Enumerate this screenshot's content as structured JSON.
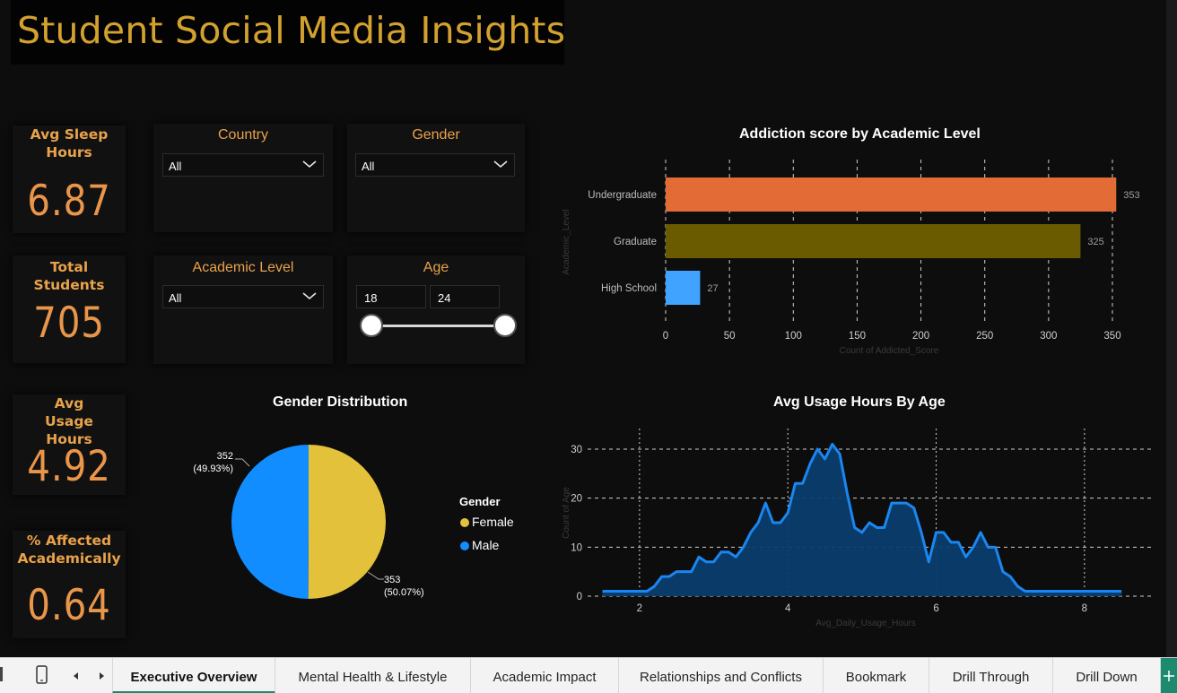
{
  "title": "Student Social Media Insights",
  "kpis": [
    {
      "label": "Avg Sleep Hours",
      "value": "6.87"
    },
    {
      "label": "Total Students",
      "value": "705"
    },
    {
      "label": "Avg Usage Hours",
      "value": "4.92"
    },
    {
      "label": "% Affected Academically",
      "value": "0.64"
    }
  ],
  "slicers": {
    "country": {
      "title": "Country",
      "value": "All"
    },
    "gender": {
      "title": "Gender",
      "value": "All"
    },
    "academic_level": {
      "title": "Academic Level",
      "value": "All"
    },
    "age": {
      "title": "Age",
      "min": "18",
      "max": "24"
    }
  },
  "charts": {
    "addiction_title": "Addiction score by Academic Level",
    "gender_title": "Gender Distribution",
    "usage_title": "Avg Usage Hours By Age"
  },
  "colors": {
    "title_gold": "#d3a12f",
    "kpi_orange": "#e9954a",
    "undergraduate": "#e36b36",
    "graduate": "#6b5b00",
    "high_school": "#3fa3ff",
    "female": "#e3c13a",
    "male": "#128dff",
    "area_line": "#1a86f0",
    "area_fill": "#0b3d6e",
    "active_tab": "#1c8a6f"
  },
  "chart_data": [
    {
      "type": "bar",
      "orientation": "horizontal",
      "title": "Addiction score by Academic Level",
      "xlabel": "Count of Addicted_Score",
      "ylabel": "Academic_Level",
      "categories": [
        "Undergraduate",
        "Graduate",
        "High School"
      ],
      "values": [
        353,
        325,
        27
      ],
      "value_labels": [
        "353",
        "325",
        "27"
      ],
      "xticks": [
        "0",
        "50",
        "100",
        "150",
        "200",
        "250",
        "300",
        "350"
      ],
      "xlim": [
        0,
        350
      ],
      "grid": "vertical dashed"
    },
    {
      "type": "pie",
      "title": "Gender Distribution",
      "legend_title": "Gender",
      "legend_placement": "right",
      "categories": [
        "Female",
        "Male"
      ],
      "values": [
        353,
        352
      ],
      "percentages": [
        "50.07%",
        "49.93%"
      ],
      "labels": [
        {
          "value": "353",
          "pct": "(50.07%)"
        },
        {
          "value": "352",
          "pct": "(49.93%)"
        }
      ]
    },
    {
      "type": "area",
      "title": "Avg Usage Hours By Age",
      "xlabel": "Avg_Daily_Usage_Hours",
      "ylabel": "Count of Age",
      "xticks": [
        "2",
        "4",
        "6",
        "8"
      ],
      "yticks": [
        "0",
        "10",
        "20",
        "30"
      ],
      "xlim": [
        1.5,
        8.5
      ],
      "ylim": [
        0,
        31
      ],
      "grid": "dashed",
      "x": [
        1.5,
        1.6,
        1.7,
        1.8,
        1.9,
        2.0,
        2.1,
        2.2,
        2.3,
        2.4,
        2.5,
        2.6,
        2.7,
        2.8,
        2.9,
        3.0,
        3.1,
        3.2,
        3.3,
        3.4,
        3.5,
        3.6,
        3.7,
        3.8,
        3.9,
        4.0,
        4.1,
        4.2,
        4.3,
        4.4,
        4.5,
        4.6,
        4.7,
        4.8,
        4.9,
        5.0,
        5.1,
        5.2,
        5.3,
        5.4,
        5.5,
        5.6,
        5.7,
        5.8,
        5.9,
        6.0,
        6.1,
        6.2,
        6.3,
        6.4,
        6.5,
        6.6,
        6.7,
        6.8,
        6.9,
        7.0,
        7.1,
        7.2,
        7.3,
        7.4,
        7.5,
        7.6,
        7.7,
        7.8,
        7.9,
        8.0,
        8.1,
        8.2,
        8.3,
        8.4,
        8.5
      ],
      "y": [
        1,
        1,
        1,
        1,
        1,
        1,
        1,
        2,
        4,
        4,
        5,
        5,
        5,
        8,
        7,
        7,
        9,
        9,
        8,
        10,
        13,
        15,
        19,
        15,
        15,
        17,
        23,
        23,
        27,
        30,
        28,
        31,
        29,
        21,
        14,
        13,
        15,
        14,
        14,
        19,
        19,
        19,
        18,
        13,
        7,
        13,
        13,
        11,
        11,
        8,
        10,
        13,
        10,
        10,
        5,
        4,
        2,
        1,
        1,
        1,
        1,
        1,
        1,
        1,
        1,
        1,
        1,
        1,
        1,
        1,
        1
      ]
    }
  ],
  "tabs": [
    {
      "label": "Executive Overview",
      "active": true
    },
    {
      "label": "Mental Health & Lifestyle",
      "active": false
    },
    {
      "label": "Academic Impact",
      "active": false
    },
    {
      "label": "Relationships and Conflicts",
      "active": false
    },
    {
      "label": "Bookmark",
      "active": false
    },
    {
      "label": "Drill Through",
      "active": false
    },
    {
      "label": "Drill Down",
      "active": false
    }
  ],
  "icons": [
    "chevron-down-icon",
    "mobile-layout-icon",
    "prev-page-icon",
    "next-page-icon"
  ]
}
